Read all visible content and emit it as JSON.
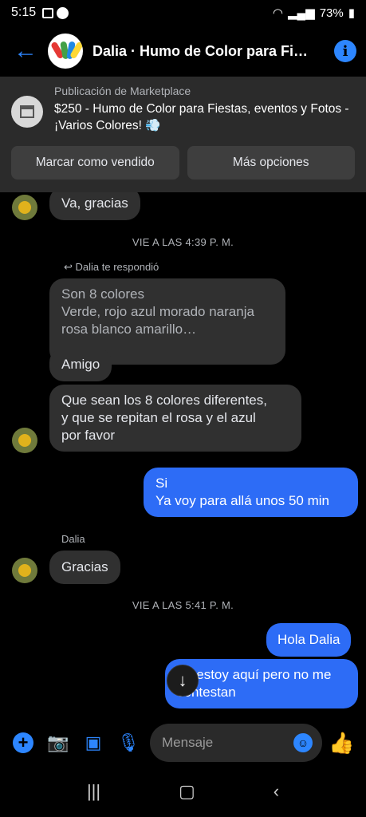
{
  "status_bar": {
    "time": "5:15",
    "battery": "73%"
  },
  "header": {
    "title": "Dalia · Humo de Color para Fiestas, eventos y Fotos"
  },
  "marketplace": {
    "label": "Publicación de Marketplace",
    "title": "$250 - Humo de Color para Fiestas, eventos y Fotos - ¡Varios Colores! 💨",
    "btn_sold": "Marcar como vendido",
    "btn_more": "Más opciones"
  },
  "messages": {
    "m1": "Va, gracias",
    "ts1": "VIE A LAS 4:39 P. M.",
    "reply_note": "↩ Dalia te respondió",
    "quoted_line1": "Son 8 colores",
    "quoted_line2": "Verde, rojo azul morado naranja",
    "quoted_line3": "rosa blanco amarillo…",
    "m2": "Amigo",
    "m3_line1": "Que sean los 8 colores diferentes,",
    "m3_line2": "y que se repitan el rosa y el azul",
    "m3_line3": "por favor",
    "me1_line1": "Si",
    "me1_line2": "Ya voy para allá unos 50 min",
    "sender_name": "Dalia",
    "m4": "Gracias",
    "ts2": "VIE A LAS 5:41 P. M.",
    "me2": "Hola Dalia",
    "me3_line1": "Ya estoy aquí pero no me",
    "me3_line2": "contestan"
  },
  "composer": {
    "placeholder": "Mensaje"
  },
  "colors": {
    "accent": "#2d86ff",
    "my_bubble": "#2d6cf6",
    "their_bubble": "#303030"
  }
}
